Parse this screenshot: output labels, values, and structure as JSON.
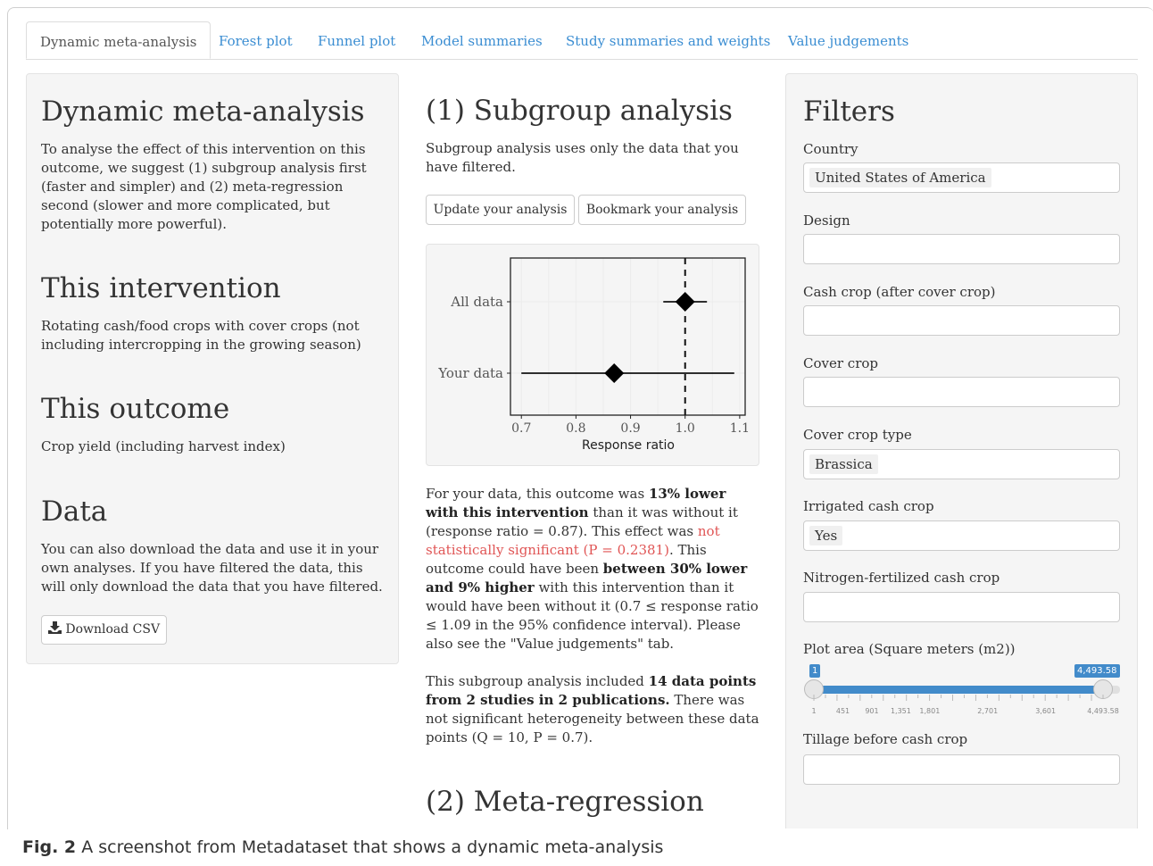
{
  "tabs": [
    {
      "label": "Dynamic meta-analysis",
      "active": true
    },
    {
      "label": "Forest plot"
    },
    {
      "label": "Funnel plot"
    },
    {
      "label": "Model summaries"
    },
    {
      "label": "Study summaries and weights"
    },
    {
      "label": "Value judgements"
    }
  ],
  "left": {
    "title": "Dynamic meta-analysis",
    "intro": "To analyse the effect of this intervention on this outcome, we suggest (1) subgroup analysis first (faster and simpler) and (2) meta-regression second (slower and more complicated, but potentially more powerful).",
    "intervention_title": "This intervention",
    "intervention_text": "Rotating cash/food crops with cover crops (not including intercropping in the growing season)",
    "outcome_title": "This outcome",
    "outcome_text": "Crop yield (including harvest index)",
    "data_title": "Data",
    "data_text": "You can also download the data and use it in your own analyses. If you have filtered the data, this will only download the data that you have filtered.",
    "download_label": "Download CSV"
  },
  "middle": {
    "title": "(1) Subgroup analysis",
    "intro": "Subgroup analysis uses only the data that you have filtered.",
    "update_label": "Update your analysis",
    "bookmark_label": "Bookmark your analysis",
    "result": {
      "t1": "For your data, this outcome was ",
      "b1": "13% lower with this intervention",
      "t2": " than it was without it (response ratio = 0.87). This effect was ",
      "r1": "not statistically significant (P = 0.2381)",
      "t3": ". This outcome could have been ",
      "b2": "between 30% lower and 9% higher",
      "t4": " with this intervention than it would have been without it (0.7 ≤ response ratio ≤ 1.09 in the 95% confidence interval). Please also see the \"Value judgements\" tab."
    },
    "included": {
      "t1": "This subgroup analysis included ",
      "b1": "14 data points from 2 studies in 2 publications.",
      "t2": " There was not significant heterogeneity between these data points (Q = 10, P = 0.7)."
    },
    "meta_title": "(2) Meta-regression"
  },
  "chart_data": {
    "type": "scatter",
    "xlabel": "Response ratio",
    "categories": [
      "All data",
      "Your data"
    ],
    "x_ticks": [
      "0.7",
      "0.8",
      "0.9",
      "1.0",
      "1.1"
    ],
    "xlim": [
      0.68,
      1.11
    ],
    "points": [
      {
        "label": "All data",
        "estimate": 1.0,
        "ci_low": 0.96,
        "ci_high": 1.04
      },
      {
        "label": "Your data",
        "estimate": 0.87,
        "ci_low": 0.7,
        "ci_high": 1.09
      }
    ],
    "reference_line": 1.0,
    "grid": true
  },
  "filters": {
    "title": "Filters",
    "country_label": "Country",
    "country_value": "United States of America",
    "design_label": "Design",
    "cash_crop_label": "Cash crop (after cover crop)",
    "cover_crop_label": "Cover crop",
    "cover_crop_type_label": "Cover crop type",
    "cover_crop_type_value": "Brassica",
    "irrigated_label": "Irrigated cash crop",
    "irrigated_value": "Yes",
    "nitrogen_label": "Nitrogen-fertilized cash crop",
    "plot_area_label": "Plot area (Square meters (m2))",
    "plot_area_min": "1",
    "plot_area_max": "4,493.58",
    "plot_area_ticks": [
      "1",
      "451",
      "901",
      "1,351",
      "1,801",
      "2,701",
      "3,601",
      "4,493.58"
    ],
    "tillage_label": "Tillage before cash crop"
  },
  "caption": {
    "fig": "Fig. 2",
    "text": " A screenshot from Metadataset that shows a dynamic meta-analysis"
  }
}
